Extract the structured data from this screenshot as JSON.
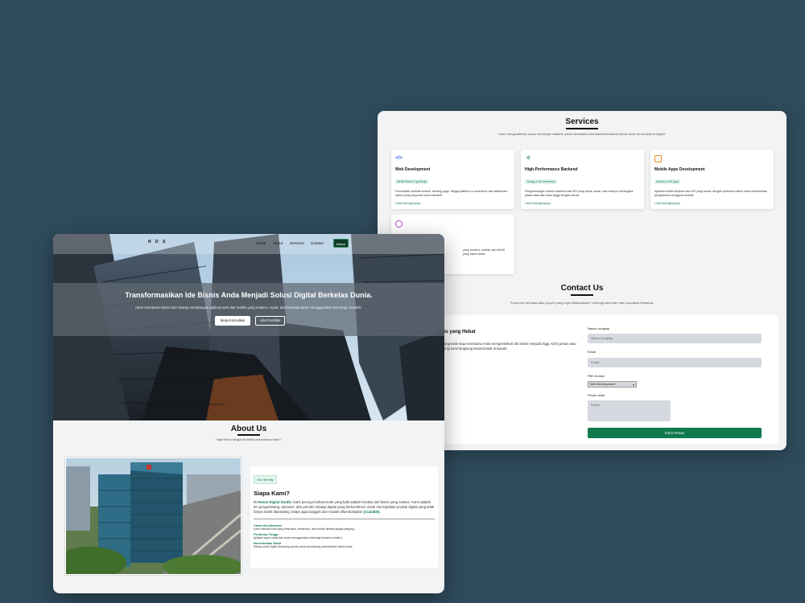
{
  "services": {
    "title": "Services",
    "subtitle": "Kami menghadirkan solusi teknologi mutakhir untuk membantu mentransformasikan bisnis Anda ke ekosistem digital.",
    "cards": [
      {
        "icon": "code-icon",
        "title": "Web Development",
        "tag": "MERN Stack & TypeScript",
        "desc": "Pembuatan website kustom, landing page, hingga platform e-commerce dan dashboard admin yang responsif serta interaktif.",
        "link": "Lihat Selengkapnya"
      },
      {
        "icon": "chip-icon",
        "title": "High-Performance Backend",
        "tag": "Golang & Gin Framework",
        "desc": "Pengembangan sistem backend dan API yang cepat, aman, dan mampu menangani jutaan data lalu lintas tinggi dengan lancar.",
        "link": "Lihat Selengkapnya"
      },
      {
        "icon": "phone-icon",
        "title": "Mobile Apps Development",
        "tag": "Android & iOS Apps",
        "desc": "Aplikasi mobile Android dan iOS yang lancar dengan performa native untuk memberikan pengalaman pengguna terbaik.",
        "link": "Lihat Selengkapnya"
      },
      {
        "icon": "palette-icon",
        "desc_partial": "yang modern, estetik, dan intuitif yang bisnis Anda."
      }
    ]
  },
  "contact": {
    "title": "Contact Us",
    "subtitle": "Punya ide liar tlasa atau proyek yang ingin didiskusikan? Hubungi kami dan mari wujudkan bersama.",
    "left_title": "uatu yang Hebat",
    "left_text": "embang kami siap membantu Anda mengeksekusi ide bisnis menjadi inggi. Kirim pesan atau hubungi kami langsung lewat kontak di bawah.",
    "name_label": "Nama Lengkap",
    "name_placeholder": "Nama Lengkap",
    "email_label": "Email",
    "email_placeholder": "Email",
    "service_label": "Pilih Konsul",
    "service_value": "Web Development",
    "message_label": "Pesan anda",
    "message_placeholder": "Pesan",
    "submit": "Kirim Pesan"
  },
  "nav": {
    "logo": "N D S",
    "links": [
      "Home",
      "About",
      "Services",
      "Contact"
    ],
    "cta": "Masuk"
  },
  "hero": {
    "title": "Transformasikan Ide Bisnis Anda Menjadi Solusi Digital Berkelas Dunia.",
    "subtitle": "Kami membantu bisnis dan startup membangun aplikasi web dan mobile yang modern, cepat, dan berskala besar menggunakan teknologi mutakhir.",
    "btn_primary": "Mulai Konsultasi",
    "btn_secondary": "Lihat Portfolio"
  },
  "about": {
    "title": "About Us",
    "subtitle": "Ingin tahu mengenai detail perusahaan kami?",
    "tag": "Our Identity",
    "heading": "Siapa Kami?",
    "desc_pre": "Di ",
    "desc_brand": "Nexus Digital Studio",
    "desc_mid": ", kami percaya bahwa kode yang baik adalah fondasi dari bisnis yang sukses. Kami adalah tim pengembang, desainer, dan pemikir strategi digital yang berkomitmen untuk menciptakan produk digital yang tidak hanya indah dipandang, tetapi juga tangguh dan mudah dikembangkan ",
    "desc_scal": "(scalable).",
    "features": [
      {
        "title": "Clean Architecture",
        "desc": "Kami menulis kode yang terstruktur, terstruktur, dan mudah dirawat jangka panjang."
      },
      {
        "title": "Performa Tinggi",
        "desc": "Aplikasi super cepat dan aman menggunakan teknologi backend modern."
      },
      {
        "title": "Berorientasi Hasil",
        "desc": "Setiap solusi digital dirancang penuh untuk mendukung pertumbuhan bisnis Anda."
      }
    ]
  },
  "colors": {
    "accent": "#0f7a4c",
    "bg": "#2f4b5c",
    "dark_btn": "#0f3d2a"
  }
}
